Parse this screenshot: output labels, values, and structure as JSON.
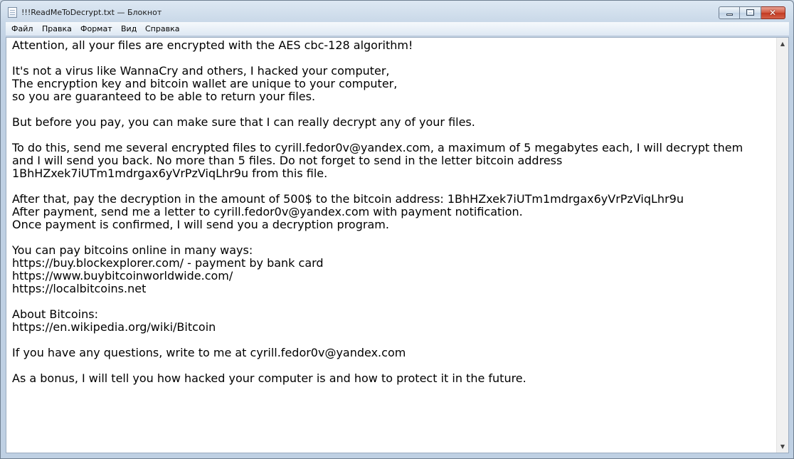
{
  "window": {
    "title": "!!!ReadMeToDecrypt.txt — Блокнот",
    "controls": {
      "minimize_icon": "minimize-icon",
      "maximize_icon": "maximize-icon",
      "close_icon": "close-icon",
      "close_glyph": "✕"
    }
  },
  "menubar": {
    "items": [
      {
        "label": "Файл"
      },
      {
        "label": "Правка"
      },
      {
        "label": "Формат"
      },
      {
        "label": "Вид"
      },
      {
        "label": "Справка"
      }
    ]
  },
  "document": {
    "lines": [
      "Attention, all your files are encrypted with the AES cbc-128 algorithm!",
      "",
      "It's not a virus like WannaCry and others, I hacked your computer,",
      "The encryption key and bitcoin wallet are unique to your computer,",
      "so you are guaranteed to be able to return your files.",
      "",
      "But before you pay, you can make sure that I can really decrypt any of your files.",
      "",
      "To do this, send me several encrypted files to cyrill.fedor0v@yandex.com, a maximum of 5 megabytes each, I will decrypt them",
      "and I will send you back. No more than 5 files. Do not forget to send in the letter bitcoin address",
      "1BhHZxek7iUTm1mdrgax6yVrPzViqLhr9u from this file.",
      "",
      "After that, pay the decryption in the amount of 500$ to the bitcoin address: 1BhHZxek7iUTm1mdrgax6yVrPzViqLhr9u",
      "After payment, send me a letter to cyrill.fedor0v@yandex.com with payment notification.",
      "Once payment is confirmed, I will send you a decryption program.",
      "",
      "You can pay bitcoins online in many ways:",
      "https://buy.blockexplorer.com/ - payment by bank card",
      "https://www.buybitcoinworldwide.com/",
      "https://localbitcoins.net",
      "",
      "About Bitcoins:",
      "https://en.wikipedia.org/wiki/Bitcoin",
      "",
      "If you have any questions, write to me at cyrill.fedor0v@yandex.com",
      "",
      "As a bonus, I will tell you how hacked your computer is and how to protect it in the future."
    ]
  },
  "scrollbar": {
    "up_arrow": "▲",
    "down_arrow": "▼"
  }
}
